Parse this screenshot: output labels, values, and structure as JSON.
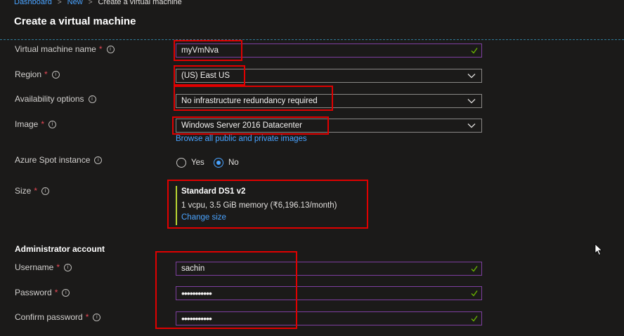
{
  "breadcrumb": {
    "items": [
      "Dashboard",
      "New"
    ],
    "current": "Create a virtual machine"
  },
  "page_title": "Create a virtual machine",
  "form": {
    "vm_name": {
      "label": "Virtual machine name",
      "required": "*",
      "value": "myVmNva"
    },
    "region": {
      "label": "Region",
      "required": "*",
      "value": "(US) East US"
    },
    "availability": {
      "label": "Availability options",
      "value": "No infrastructure redundancy required"
    },
    "image": {
      "label": "Image",
      "required": "*",
      "value": "Windows Server 2016 Datacenter",
      "link": "Browse all public and private images"
    },
    "spot": {
      "label": "Azure Spot instance",
      "options": [
        "Yes",
        "No"
      ],
      "selected": "No"
    },
    "size": {
      "label": "Size",
      "required": "*",
      "name": "Standard DS1 v2",
      "description": "1 vcpu, 3.5 GiB memory (₹6,196.13/month)",
      "link": "Change size"
    }
  },
  "admin": {
    "heading": "Administrator account",
    "username": {
      "label": "Username",
      "required": "*",
      "value": "sachin"
    },
    "password": {
      "label": "Password",
      "required": "*",
      "value": "•••••••••••"
    },
    "confirm_password": {
      "label": "Confirm password",
      "required": "*",
      "value": "•••••••••••"
    }
  },
  "icons": {
    "info": "info-icon",
    "check": "check-icon",
    "chevron": "chevron-down-icon",
    "cursor": "mouse-pointer-icon"
  },
  "colors": {
    "accent": "#4aa3ff",
    "valid_check": "#6bb700",
    "highlight": "#e00000",
    "size_bar": "#b8d432",
    "required": "#e74856"
  }
}
